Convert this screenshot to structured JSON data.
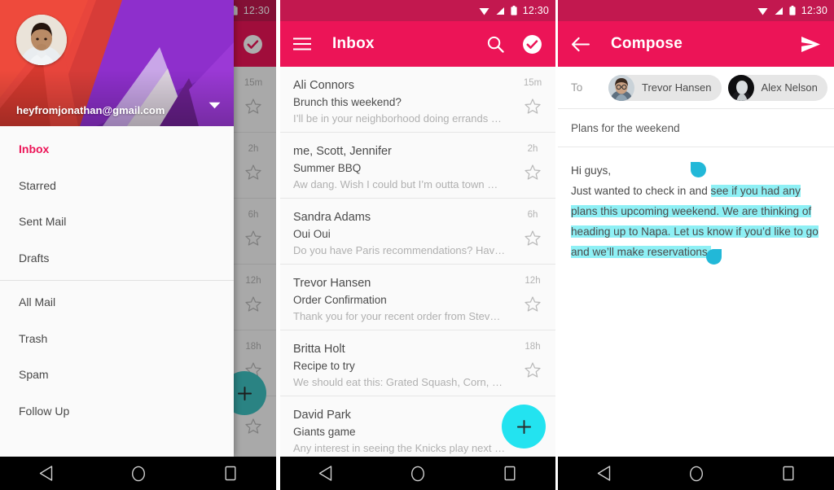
{
  "statusbar": {
    "time": "12:30",
    "wifi_icon": "wifi-icon",
    "signal_icon": "signal-icon",
    "battery_icon": "battery-icon"
  },
  "navbar": {
    "back": "back-triangle-icon",
    "home": "home-circle-icon",
    "recents": "recents-square-icon"
  },
  "panel1": {
    "drawer": {
      "account_email": "heyfromjonathan@gmail.com",
      "caret_icon": "chevron-down-icon",
      "avatar": "account-avatar",
      "items": [
        {
          "label": "Inbox",
          "active": true
        },
        {
          "label": "Starred",
          "active": false
        },
        {
          "label": "Sent Mail",
          "active": false
        },
        {
          "label": "Drafts",
          "active": false
        }
      ],
      "items2": [
        {
          "label": "All Mail",
          "active": false
        },
        {
          "label": "Trash",
          "active": false
        },
        {
          "label": "Spam",
          "active": false
        },
        {
          "label": "Follow Up",
          "active": false
        }
      ]
    },
    "scrim_times": [
      "15m",
      "2h",
      "6h",
      "12h",
      "18h"
    ],
    "check_icon": "check-circle-icon",
    "fab_label": "+",
    "fab_color": "#3fc2c2"
  },
  "panel2": {
    "appbar": {
      "menu_icon": "hamburger-menu-icon",
      "title": "Inbox",
      "search_icon": "search-icon",
      "check_icon": "check-circle-icon"
    },
    "fab_label": "+",
    "fab_color": "#23e3f0",
    "messages": [
      {
        "sender": "Ali Connors",
        "subject": "Brunch this weekend?",
        "snippet": "I’ll be in your neighborhood doing errands …",
        "time": "15m",
        "starred": false
      },
      {
        "sender": "me, Scott, Jennifer",
        "subject": "Summer BBQ",
        "snippet": "Aw dang. Wish I could but I’m outta town …",
        "time": "2h",
        "starred": false
      },
      {
        "sender": "Sandra Adams",
        "subject": "Oui Oui",
        "snippet": "Do you have Paris recommendations? Hav…",
        "time": "6h",
        "starred": false
      },
      {
        "sender": "Trevor Hansen",
        "subject": "Order Confirmation",
        "snippet": "Thank you for your recent order from Stev…",
        "time": "12h",
        "starred": false
      },
      {
        "sender": "Britta Holt",
        "subject": "Recipe to try",
        "snippet": "We should eat this: Grated Squash, Corn, …",
        "time": "18h",
        "starred": false
      },
      {
        "sender": "David Park",
        "subject": "Giants game",
        "snippet": "Any interest in seeing the Knicks play next …",
        "time": "",
        "starred": false
      }
    ]
  },
  "panel3": {
    "appbar": {
      "back_icon": "arrow-back-icon",
      "title": "Compose",
      "send_icon": "send-icon"
    },
    "to_label": "To",
    "recipients": [
      {
        "name": "Trevor Hansen",
        "avatar": "recipient-avatar-trevor"
      },
      {
        "name": "Alex Nelson",
        "avatar": "recipient-avatar-alex"
      }
    ],
    "subject": "Plans for the weekend",
    "body_lines": [
      {
        "plain": "Hi guys,",
        "highlight": ""
      },
      {
        "plain": "Just wanted to check in and ",
        "highlight": "see if you had any"
      },
      {
        "plain": "",
        "highlight": "plans this upcoming weekend. We are thinking of"
      },
      {
        "plain": "",
        "highlight": "heading up to Napa. Let us know if you’d like to go"
      },
      {
        "plain": "",
        "highlight": "and we’ll make reservations."
      }
    ],
    "selection_highlight_color": "#8ef0f5",
    "selection_handle_color": "#22b8d8"
  },
  "colors": {
    "appbar_pink": "#ec1457",
    "statusbar_pink": "#c2184f",
    "accent_cyan": "#23e3f0",
    "list_bg": "#fafafa"
  }
}
